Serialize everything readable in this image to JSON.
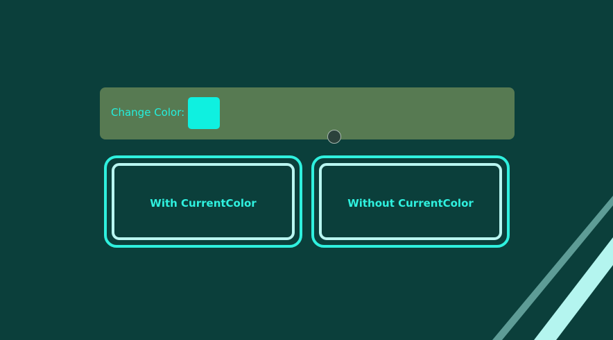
{
  "colors": {
    "background": "#0b3f3b",
    "panel": "#577a52",
    "accent": "#2ff0de",
    "inner_border": "#b9f6f1",
    "swatch": "#0ff0e0"
  },
  "panel": {
    "label": "Change Color:"
  },
  "cards": {
    "with_label": "With CurrentColor",
    "without_label": "Without CurrentColor"
  }
}
